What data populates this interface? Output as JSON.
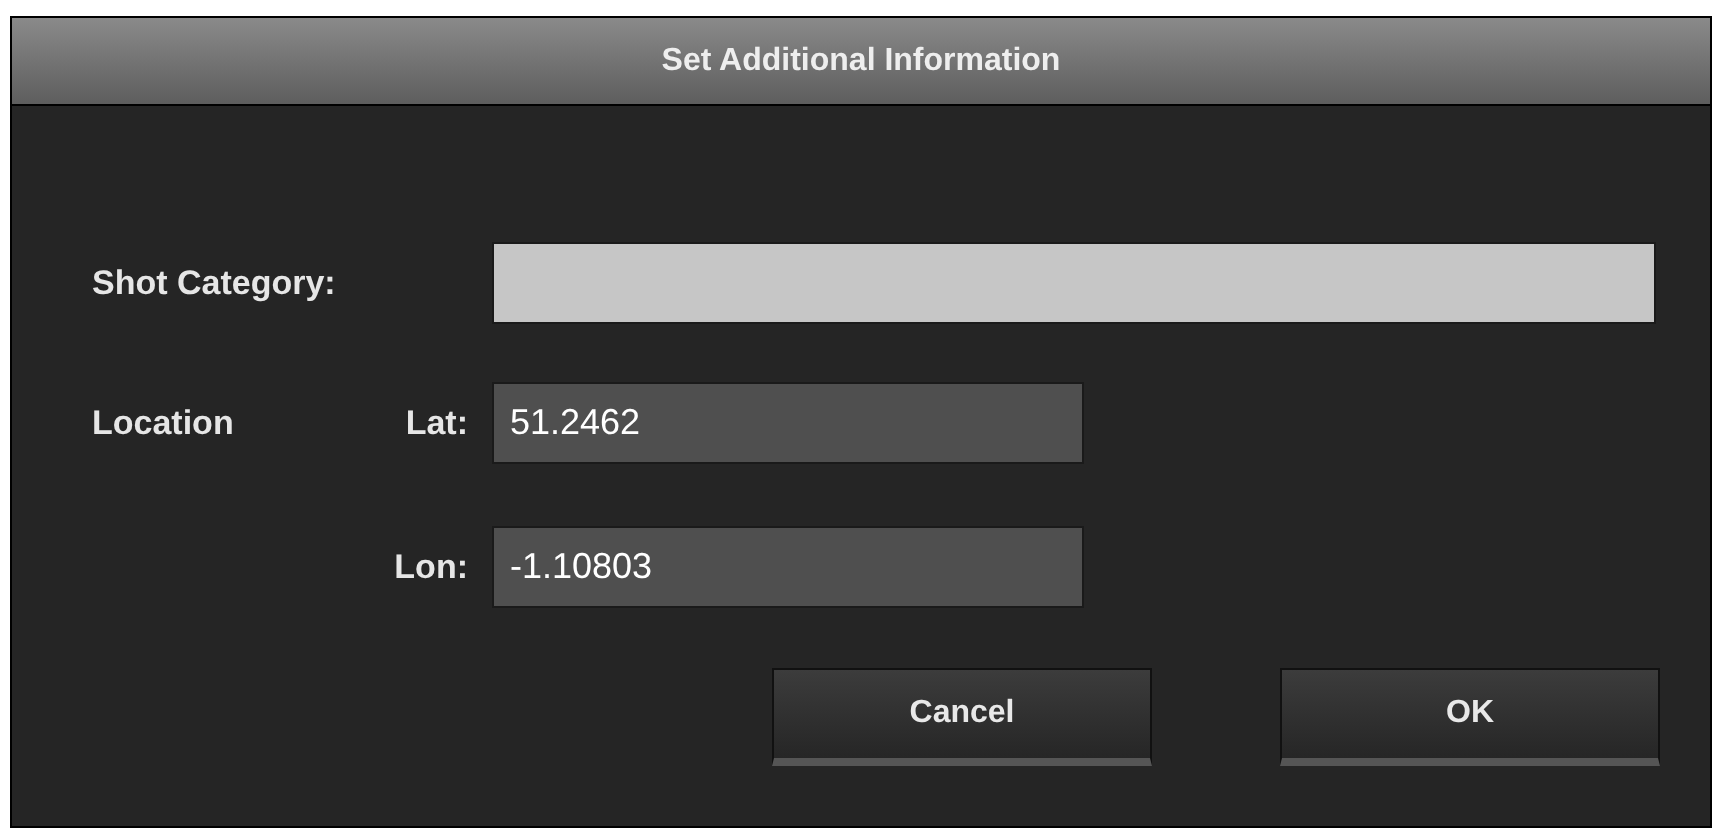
{
  "window": {
    "title": "Set Additional Information"
  },
  "shot_category": {
    "label": "Shot Category:"
  },
  "location": {
    "label": "Location",
    "lat": {
      "label": "Lat:",
      "value": "51.2462"
    },
    "lon": {
      "label": "Lon:",
      "value": "-1.10803"
    }
  },
  "buttons": [
    {
      "label": "Cancel"
    },
    {
      "label": "OK"
    }
  ]
}
